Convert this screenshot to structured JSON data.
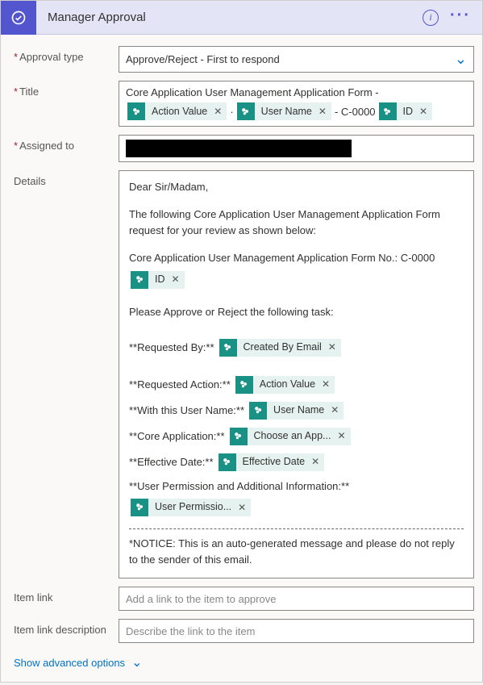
{
  "header": {
    "title": "Manager Approval"
  },
  "fields": {
    "approvalType": {
      "label": "Approval type",
      "value": "Approve/Reject - First to respond"
    },
    "title": {
      "label": "Title",
      "prefix": "Core Application User Management Application Form -",
      "mid": " - C-0000"
    },
    "assignedTo": {
      "label": "Assigned to"
    },
    "details": {
      "label": "Details"
    },
    "itemLink": {
      "label": "Item link",
      "placeholder": "Add a link to the item to approve"
    },
    "itemLinkDesc": {
      "label": "Item link description",
      "placeholder": "Describe the link to the item"
    }
  },
  "tokens": {
    "actionValue": "Action Value",
    "userName": "User Name",
    "id": "ID",
    "createdByEmail": "Created By Email",
    "chooseApp": "Choose an App...",
    "effectiveDate": "Effective Date",
    "userPermissio": "User Permissio..."
  },
  "details": {
    "greeting": "Dear Sir/Madam,",
    "intro": "The following Core Application User Management Application Form request for your review as shown below:",
    "formNo": "Core Application User Management Application Form No.: C-0000",
    "instr": "Please Approve or Reject the following task:",
    "reqBy": "**Requested By:**",
    "reqAction": "**Requested Action:**",
    "withUser": "**With this User Name:**",
    "coreApp": "**Core Application:**",
    "effDate": "**Effective Date:**",
    "userPerm": "**User Permission and Additional Information:**",
    "notice": "*NOTICE: This is an auto-generated message and please do not reply to the sender of this email."
  },
  "footer": {
    "advanced": "Show advanced options"
  }
}
